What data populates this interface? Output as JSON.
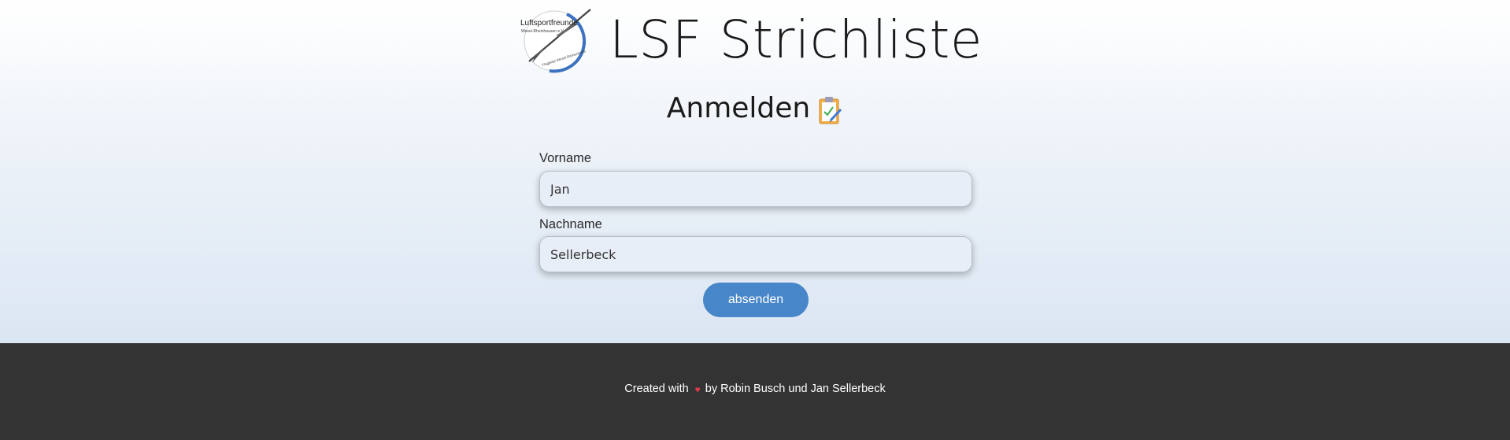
{
  "header": {
    "title": "LSF Strichliste",
    "logo": {
      "icon": "club-logo-icon",
      "text_top": "Luftsportfreunde",
      "text_sub": "Wesel-Rheinhausen e.V.",
      "text_bottom": "Flugplatz Wesel-Römerwardt"
    }
  },
  "form": {
    "heading": "Anmelden",
    "heading_icon": "clipboard-icon",
    "firstname": {
      "label": "Vorname",
      "value": "Jan"
    },
    "lastname": {
      "label": "Nachname",
      "value": "Sellerbeck"
    },
    "submit_label": "absenden"
  },
  "footer": {
    "prefix": "Created with",
    "heart_icon": "heart-icon",
    "suffix": "by Robin Busch und Jan Sellerbeck"
  },
  "colors": {
    "accent": "#4786c8",
    "footer_bg": "#333333",
    "heart": "#e03c4a"
  }
}
